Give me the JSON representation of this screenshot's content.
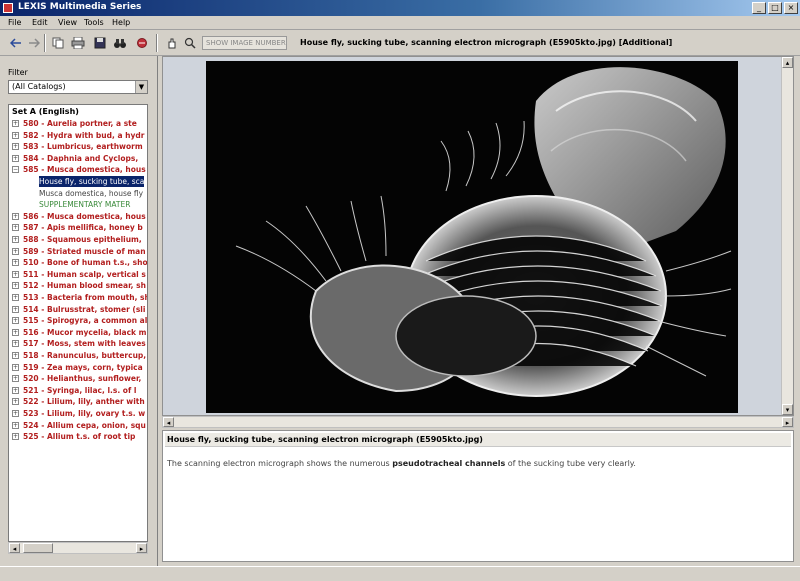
{
  "window": {
    "title": "LEXIS Multimedia Series",
    "controls": [
      "_",
      "□",
      "×"
    ]
  },
  "menu": [
    "File",
    "Edit",
    "View",
    "Tools",
    "Help"
  ],
  "toolbar": {
    "icons": [
      "back-icon",
      "forward-icon",
      "copy-icon",
      "print-icon",
      "save-icon",
      "binoculars-icon",
      "bookmark-icon",
      "hand-icon",
      "magnifier-icon"
    ],
    "field_placeholder": "SHOW IMAGE NUMBERS",
    "caption": "House fly, sucking tube, scanning electron micrograph  (E5905kto.jpg) [Additional]"
  },
  "sidebar": {
    "filter_label": "Filter",
    "filter_value": "(All Catalogs)",
    "tree_root": "Set A (English)",
    "items": [
      {
        "label": "580 - Aurelia portner, a ste",
        "kind": "parent"
      },
      {
        "label": "582 - Hydra with bud, a hydr",
        "kind": "parent"
      },
      {
        "label": "583 - Lumbricus, earthworm",
        "kind": "parent"
      },
      {
        "label": "584 - Daphnia and Cyclops,",
        "kind": "parent"
      },
      {
        "label": "585 - Musca domestica, hous",
        "kind": "expanded"
      },
      {
        "label": "House fly, sucking tube, sca",
        "kind": "selected"
      },
      {
        "label": "Musca domestica, house fly",
        "kind": "normal"
      },
      {
        "label": "SUPPLEMENTARY MATER",
        "kind": "green"
      },
      {
        "label": "586 - Musca domestica, hous",
        "kind": "parent"
      },
      {
        "label": "587 - Apis mellifica, honey b",
        "kind": "parent"
      },
      {
        "label": "588 - Squamous epithelium,",
        "kind": "parent"
      },
      {
        "label": "589 - Striated muscle of man",
        "kind": "parent"
      },
      {
        "label": "510 - Bone of human t.s., sho",
        "kind": "parent"
      },
      {
        "label": "511 - Human scalp, vertical s",
        "kind": "parent"
      },
      {
        "label": "512 - Human blood smear, sh",
        "kind": "parent"
      },
      {
        "label": "513 - Bacteria from mouth, sh",
        "kind": "parent"
      },
      {
        "label": "514 - Bulrusstrat, stomer (sli",
        "kind": "parent"
      },
      {
        "label": "515 - Spirogyra, a common al",
        "kind": "parent"
      },
      {
        "label": "516 - Mucor mycelia, black m",
        "kind": "parent"
      },
      {
        "label": "517 - Moss, stem with leaves",
        "kind": "parent"
      },
      {
        "label": "518 - Ranunculus, buttercup, r",
        "kind": "parent"
      },
      {
        "label": "519 - Zea mays, corn, typica",
        "kind": "parent"
      },
      {
        "label": "520 - Helianthus, sunflower,",
        "kind": "parent"
      },
      {
        "label": "521 - Syringa, lilac, l.s. of l",
        "kind": "parent"
      },
      {
        "label": "522 - Lilium, lily, anther with",
        "kind": "parent"
      },
      {
        "label": "523 - Lilium, lily, ovary t.s. w",
        "kind": "parent"
      },
      {
        "label": "524 - Allium cepa, onion, squ",
        "kind": "parent"
      },
      {
        "label": "525 - Allium t.s. of root tip",
        "kind": "parent"
      }
    ]
  },
  "description": {
    "title": "House fly, sucking tube, scanning electron micrograph  (E5905kto.jpg)",
    "text_before": "The scanning electron micrograph shows the numerous",
    "text_bold": "pseudotracheal channels",
    "text_after": "of the sucking tube very clearly."
  },
  "colors": {
    "tree_red": "#b21e1e",
    "selection_blue": "#0a246a",
    "photo_bg": "#050505"
  }
}
